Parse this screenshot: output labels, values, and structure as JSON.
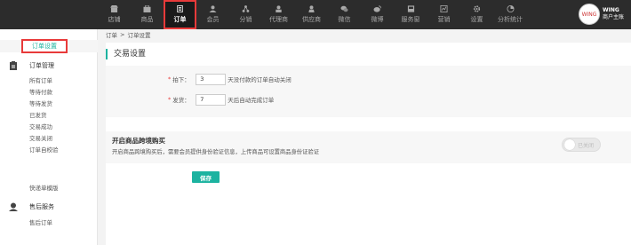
{
  "topnav": {
    "items": [
      {
        "label": "店铺",
        "icon": "store-icon"
      },
      {
        "label": "商品",
        "icon": "goods-icon"
      },
      {
        "label": "订单",
        "icon": "order-icon",
        "active": true
      },
      {
        "label": "会员",
        "icon": "member-icon"
      },
      {
        "label": "分销",
        "icon": "distribution-icon"
      },
      {
        "label": "代理商",
        "icon": "agent-icon"
      },
      {
        "label": "供应商",
        "icon": "supplier-icon"
      },
      {
        "label": "微信",
        "icon": "wechat-icon"
      },
      {
        "label": "微博",
        "icon": "weibo-icon"
      },
      {
        "label": "服务窗",
        "icon": "service-window-icon"
      },
      {
        "label": "营销",
        "icon": "marketing-icon"
      },
      {
        "label": "设置",
        "icon": "settings-icon"
      },
      {
        "label": "分析统计",
        "icon": "analytics-icon"
      }
    ],
    "user": {
      "name": "WING",
      "role": "商户主账",
      "avatar_text": "WING"
    }
  },
  "sidebar": {
    "active_item": "订单设置",
    "order_section": {
      "title": "订单管理",
      "links": [
        "所有订单",
        "等待付款",
        "等待发货",
        "已发货",
        "交易成功",
        "交易关闭",
        "订单自校验"
      ]
    },
    "express_link": "快递单模版",
    "aftersale_section": {
      "title": "售后服务",
      "links": [
        "售后订单"
      ]
    }
  },
  "breadcrumb": {
    "root": "订单",
    "sep": ">",
    "current": "订单设置"
  },
  "main": {
    "section_title": "交易设置",
    "form": {
      "order_label": "拍下：",
      "order_value": "3",
      "order_suffix": "天没付款的订单自动关闭",
      "ship_label": "发货：",
      "ship_value": "7",
      "ship_suffix": "天后自动完成订单",
      "required_mark": "*"
    },
    "cross_border": {
      "title": "开启商品跨境购买",
      "desc": "开启商品跨境购买后，需要会员提供身份验证信息，上传商品可设置商品身份证验证",
      "toggle_label": "已关闭",
      "enabled": false
    },
    "save_label": "保存"
  },
  "colors": {
    "accent": "#1cb3a0",
    "highlight": "#e83a3a",
    "topbar": "#2c2c2c"
  }
}
